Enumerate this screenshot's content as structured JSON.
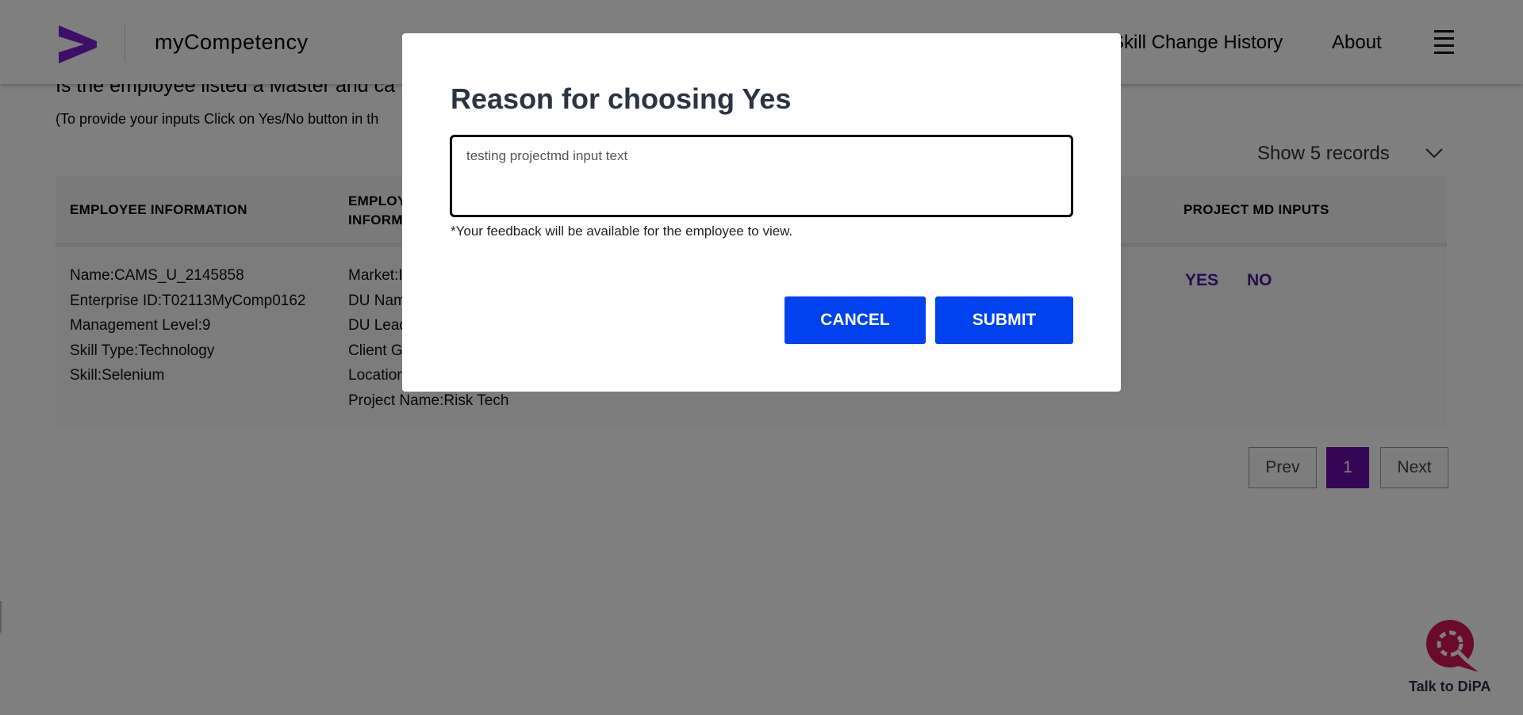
{
  "header": {
    "app_title": "myCompetency",
    "nav_skill_history": "Skill Change History",
    "nav_about": "About",
    "brand_color": "#7b1fd1"
  },
  "page": {
    "question": "Is the employee listed a Master and ca",
    "instruction": "(To provide your inputs Click on Yes/No button in th",
    "records_label": "Show 5 records"
  },
  "table": {
    "headers": {
      "employee_information": "EMPLOYEE INFORMATION",
      "employment_information": "EMPLOY\nINFORM",
      "project_md_inputs": "PROJECT MD INPUTS"
    },
    "row": {
      "employee": [
        "Name:CAMS_U_2145858",
        "Enterprise ID:T02113MyComp0162",
        "Management Level:9",
        "Skill Type:Technology",
        "Skill:Selenium"
      ],
      "employment": [
        "Market:I",
        "DU Nam",
        "DU Lead",
        "Client G",
        "Location",
        "Project Name:Risk Tech"
      ],
      "yes_label": "YES",
      "no_label": "NO"
    }
  },
  "pagination": {
    "prev_label": "Prev",
    "current_page": "1",
    "next_label": "Next"
  },
  "chat": {
    "label": "Talk to DiPA"
  },
  "modal": {
    "title": "Reason for choosing Yes",
    "textarea_value": "testing projectmd input text",
    "note": "*Your feedback will be available for the employee to view.",
    "cancel_label": "CANCEL",
    "submit_label": "SUBMIT",
    "button_color": "#0041f0"
  }
}
